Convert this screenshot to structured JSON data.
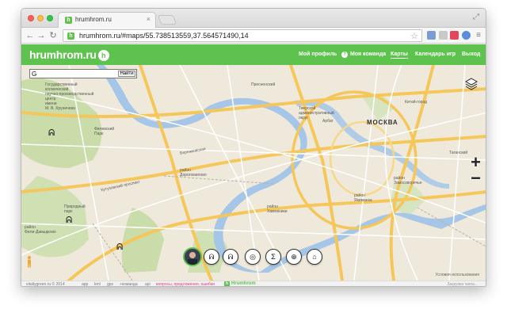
{
  "browser": {
    "tab_title": "hrumhrom.ru",
    "tab_close": "×",
    "url": "hrumhrom.ru/#maps/55.738513559,37.564571490,14",
    "star": "☆",
    "favicon_letter": "h",
    "extensions": [
      "shield-icon",
      "pocket-icon",
      "dot-icon"
    ],
    "menu": "≡",
    "back": "←",
    "forward": "→",
    "reload": "↻"
  },
  "site": {
    "logo": "hrumhrom.ru",
    "logo_badge": "h",
    "nav": {
      "profile": "Мой профиль",
      "team": "Моя команда",
      "team_icon": "?",
      "maps": "Карты",
      "calendar": "Календарь игр",
      "logout": "Выход"
    },
    "brand_color": "#5ec24e"
  },
  "map": {
    "search_value": "G",
    "search_button": "Найти",
    "city_label": "МОСКВА",
    "labels": {
      "forest_park": "Государственный\nкосмический\nнаучно-производственный\nцентр\nимени\nМ. В. Хруничева",
      "park": "Филевский\nПарк",
      "dorogomilovo": "район\nДорогомилово",
      "presnensky": "Пресненский",
      "arbat": "Арбат",
      "khamovniki": "район\nХамовники",
      "zamoskvorechye": "район\nЗамоскворечье",
      "yakimanka": "район\nЯкиманка",
      "fili": "район\nФили-Давыдково",
      "park2": "Природный\nпарк",
      "tverskoy": "Тверской\nадминистративный\nокруг",
      "kitay": "Китай-город",
      "tagansky": "Таганский",
      "kutuzovsky": "Кутузовский проспект",
      "berezhkovskaya": "Бережковская"
    },
    "zoom_in": "+",
    "zoom_out": "−",
    "attribution": "Условия использования",
    "tools": [
      "user-avatar",
      "bunny-down-icon",
      "bunny-up-icon",
      "crosshair-icon",
      "sigma-icon",
      "target-icon",
      "home-icon"
    ],
    "tool_glyphs": {
      "crosshair": "◎",
      "sigma": "Σ",
      "target": "⊕",
      "home": "⌂"
    }
  },
  "footer": {
    "copyright": "vitaliygreen.ru © 2014",
    "links": [
      "app",
      "kml",
      "gps",
      "+команда",
      "api"
    ],
    "feedback": "вопросы, предложения, ошибки",
    "brand": "Hrumhrom",
    "brand_badge": "h",
    "loading": "Загрузка чата..."
  }
}
